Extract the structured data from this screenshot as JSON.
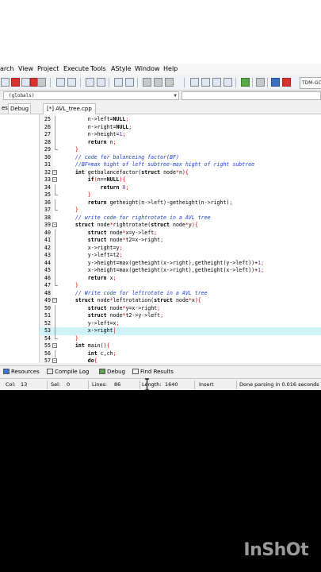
{
  "menu": [
    "arch",
    "View",
    "Project",
    "Execute",
    "Tools",
    "AStyle",
    "Window",
    "Help"
  ],
  "toolbar": {
    "compiler_select": "TDM-GCC"
  },
  "scope": {
    "value": "(globals)"
  },
  "left_tabs": [
    "es",
    "Debug"
  ],
  "file_tab": "[*] AVL_tree.cpp",
  "editor": {
    "lines": [
      {
        "n": "25",
        "fold": "line",
        "code": [
          [
            "t",
            "        n->left="
          ],
          [
            "k",
            "NULL"
          ],
          [
            "p",
            ";"
          ]
        ]
      },
      {
        "n": "26",
        "fold": "line",
        "code": [
          [
            "t",
            "        n->right="
          ],
          [
            "k",
            "NULL"
          ],
          [
            "p",
            ";"
          ]
        ]
      },
      {
        "n": "27",
        "fold": "line",
        "code": [
          [
            "t",
            "        n->height="
          ],
          [
            "n",
            "1"
          ],
          [
            "p",
            ";"
          ]
        ]
      },
      {
        "n": "28",
        "fold": "line",
        "code": [
          [
            "t",
            "        "
          ],
          [
            "k",
            "return"
          ],
          [
            "t",
            " n"
          ],
          [
            "p",
            ";"
          ]
        ]
      },
      {
        "n": "29",
        "fold": "end",
        "code": [
          [
            "t",
            "    "
          ],
          [
            "p",
            "}"
          ]
        ]
      },
      {
        "n": "30",
        "fold": "",
        "code": [
          [
            "c",
            "    // code for balanceing factor(BF)"
          ]
        ]
      },
      {
        "n": "31",
        "fold": "",
        "code": [
          [
            "c",
            "    //BF=max hight of left subtree-max hight of right subtree"
          ]
        ]
      },
      {
        "n": "32",
        "fold": "open",
        "code": [
          [
            "k",
            "    int"
          ],
          [
            "t",
            " getbalancefactor("
          ],
          [
            "k",
            "struct"
          ],
          [
            "t",
            " node"
          ],
          [
            "p",
            "*"
          ],
          [
            "t",
            "n"
          ],
          [
            "p",
            ")"
          ],
          [
            "p",
            "{"
          ]
        ]
      },
      {
        "n": "33",
        "fold": "open",
        "code": [
          [
            "t",
            "        "
          ],
          [
            "k",
            "if"
          ],
          [
            "p",
            "("
          ],
          [
            "t",
            "n=="
          ],
          [
            "k",
            "NULL"
          ],
          [
            "p",
            ")"
          ],
          [
            "p",
            "{"
          ]
        ]
      },
      {
        "n": "34",
        "fold": "line",
        "code": [
          [
            "t",
            "            "
          ],
          [
            "k",
            "return"
          ],
          [
            "t",
            " "
          ],
          [
            "n",
            "0"
          ],
          [
            "p",
            ";"
          ]
        ]
      },
      {
        "n": "35",
        "fold": "end",
        "code": [
          [
            "t",
            "        "
          ],
          [
            "p",
            "}"
          ]
        ]
      },
      {
        "n": "36",
        "fold": "line",
        "code": [
          [
            "t",
            "        "
          ],
          [
            "k",
            "return"
          ],
          [
            "t",
            " getheight(n->left)-getheight(n->right)"
          ],
          [
            "p",
            ";"
          ]
        ]
      },
      {
        "n": "37",
        "fold": "end",
        "code": [
          [
            "t",
            "    "
          ],
          [
            "p",
            "}"
          ]
        ]
      },
      {
        "n": "38",
        "fold": "",
        "code": [
          [
            "c",
            "    // write code for rightrotate in a AVL tree"
          ]
        ]
      },
      {
        "n": "39",
        "fold": "open",
        "code": [
          [
            "k",
            "    struct"
          ],
          [
            "t",
            " node"
          ],
          [
            "p",
            "*"
          ],
          [
            "t",
            "rightrotate("
          ],
          [
            "k",
            "struct"
          ],
          [
            "t",
            " node"
          ],
          [
            "p",
            "*"
          ],
          [
            "t",
            "y"
          ],
          [
            "p",
            ")"
          ],
          [
            "p",
            "{"
          ]
        ]
      },
      {
        "n": "40",
        "fold": "line",
        "code": [
          [
            "t",
            "        "
          ],
          [
            "k",
            "struct"
          ],
          [
            "t",
            " node"
          ],
          [
            "p",
            "*"
          ],
          [
            "t",
            "x=y->left"
          ],
          [
            "p",
            ";"
          ]
        ]
      },
      {
        "n": "41",
        "fold": "line",
        "code": [
          [
            "t",
            "        "
          ],
          [
            "k",
            "struct"
          ],
          [
            "t",
            " node"
          ],
          [
            "p",
            "*"
          ],
          [
            "t",
            "t2=x->right"
          ],
          [
            "p",
            ";"
          ]
        ]
      },
      {
        "n": "42",
        "fold": "line",
        "code": [
          [
            "t",
            "        x->right=y"
          ],
          [
            "p",
            ";"
          ]
        ]
      },
      {
        "n": "43",
        "fold": "line",
        "code": [
          [
            "t",
            "        y->left=t2"
          ],
          [
            "p",
            ";"
          ]
        ]
      },
      {
        "n": "44",
        "fold": "line",
        "code": [
          [
            "t",
            "        y->height=max(getheight(x->right),getheight(y->left))+"
          ],
          [
            "n",
            "1"
          ],
          [
            "p",
            ";"
          ]
        ]
      },
      {
        "n": "45",
        "fold": "line",
        "code": [
          [
            "t",
            "        x->height=max(getheight(x->right),getheight(x->left))+"
          ],
          [
            "n",
            "1"
          ],
          [
            "p",
            ";"
          ]
        ]
      },
      {
        "n": "46",
        "fold": "line",
        "code": [
          [
            "t",
            "        "
          ],
          [
            "k",
            "return"
          ],
          [
            "t",
            " x"
          ],
          [
            "p",
            ";"
          ]
        ]
      },
      {
        "n": "47",
        "fold": "end",
        "code": [
          [
            "t",
            "    "
          ],
          [
            "p",
            "}"
          ]
        ]
      },
      {
        "n": "48",
        "fold": "",
        "code": [
          [
            "c",
            "    // Write code for leftrotate in a AVL tree"
          ]
        ]
      },
      {
        "n": "49",
        "fold": "open",
        "code": [
          [
            "k",
            "    struct"
          ],
          [
            "t",
            " node"
          ],
          [
            "p",
            "*"
          ],
          [
            "t",
            "leftrotation("
          ],
          [
            "k",
            "struct"
          ],
          [
            "t",
            " node"
          ],
          [
            "p",
            "*"
          ],
          [
            "t",
            "x"
          ],
          [
            "p",
            ")"
          ],
          [
            "p",
            "{"
          ]
        ]
      },
      {
        "n": "50",
        "fold": "line",
        "code": [
          [
            "t",
            "        "
          ],
          [
            "k",
            "struct"
          ],
          [
            "t",
            " node"
          ],
          [
            "p",
            "*"
          ],
          [
            "t",
            "y=x->right"
          ],
          [
            "p",
            ";"
          ]
        ]
      },
      {
        "n": "51",
        "fold": "line",
        "code": [
          [
            "t",
            "        "
          ],
          [
            "k",
            "struct"
          ],
          [
            "t",
            " node"
          ],
          [
            "p",
            "*"
          ],
          [
            "t",
            "t2->y->left"
          ],
          [
            "p",
            ";"
          ]
        ]
      },
      {
        "n": "52",
        "fold": "line",
        "code": [
          [
            "t",
            "        y->left=x"
          ],
          [
            "p",
            ";"
          ]
        ]
      },
      {
        "n": "53",
        "fold": "line",
        "current": true,
        "code": [
          [
            "t",
            "        x->right"
          ],
          [
            "p",
            "|"
          ]
        ]
      },
      {
        "n": "54",
        "fold": "end",
        "code": [
          [
            "t",
            "    "
          ],
          [
            "p",
            "}"
          ]
        ]
      },
      {
        "n": "55",
        "fold": "open",
        "code": [
          [
            "k",
            "    int"
          ],
          [
            "t",
            " main()"
          ],
          [
            "p",
            "{"
          ]
        ]
      },
      {
        "n": "56",
        "fold": "line",
        "code": [
          [
            "k",
            "        int"
          ],
          [
            "t",
            " c,ch"
          ],
          [
            "p",
            ";"
          ]
        ]
      },
      {
        "n": "57",
        "fold": "open",
        "code": [
          [
            "t",
            "        "
          ],
          [
            "k",
            "do"
          ],
          [
            "p",
            "{"
          ]
        ]
      }
    ]
  },
  "bottom_tabs": {
    "resources": "Resources",
    "compile_log": "Compile Log",
    "debug": "Debug",
    "find_results": "Find Results"
  },
  "status": {
    "col_label": "Col:",
    "col": "13",
    "sel_label": "Sel:",
    "sel": "0",
    "lines_label": "Lines:",
    "lines": "86",
    "length_label": "Length:",
    "length": "1640",
    "mode": "Insert",
    "parse": "Done parsing in 0.016 seconds"
  },
  "watermark": "InShOt",
  "colors": {
    "keyword": "#000000",
    "symbol": "#d00000",
    "number": "#7a2bd6",
    "comment": "#1c3fd0",
    "current_line": "#cff2f7"
  }
}
